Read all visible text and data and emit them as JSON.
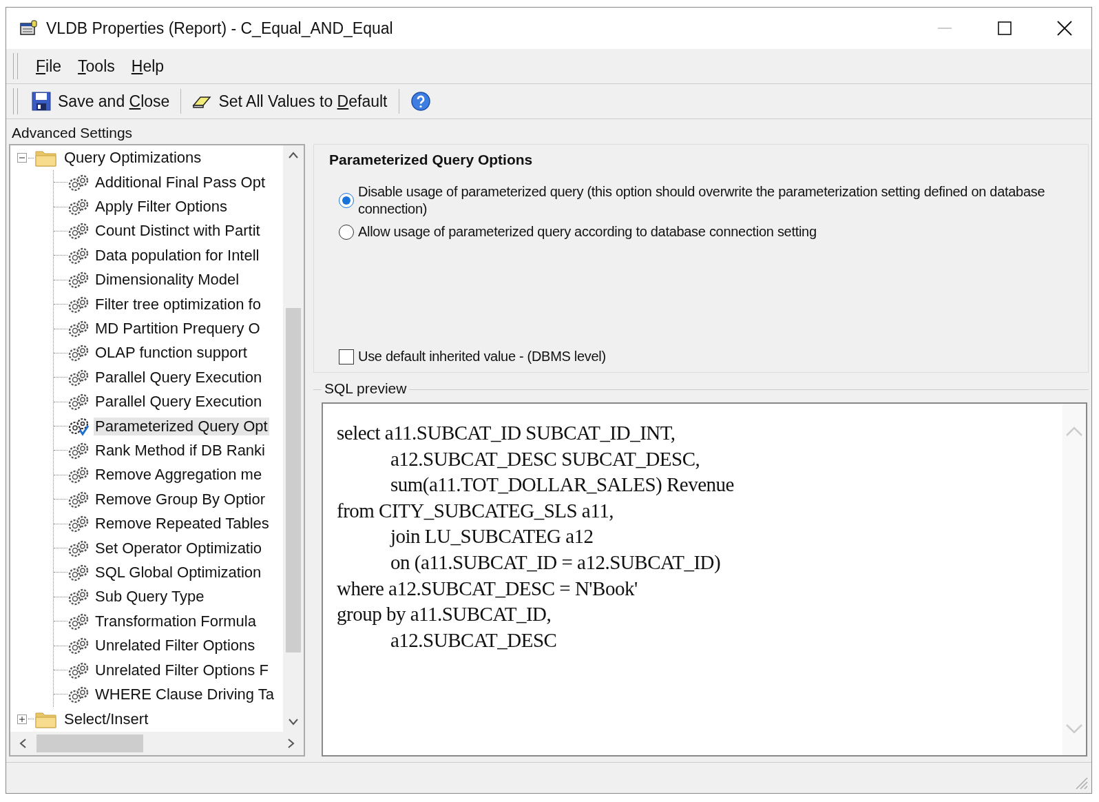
{
  "window": {
    "title": "VLDB Properties (Report) - C_Equal_AND_Equal"
  },
  "menu": [
    {
      "access_key": "F",
      "label_rest": "ile"
    },
    {
      "access_key": "T",
      "label_rest": "ools"
    },
    {
      "access_key": "H",
      "label_rest": "elp"
    }
  ],
  "toolbar": [
    {
      "kind": "save",
      "label_start": "Save and ",
      "access_key": "C",
      "label_rest": "lose"
    },
    {
      "kind": "default",
      "label_start": "Set All Values to ",
      "access_key": "D",
      "label_rest": "efault"
    },
    {
      "kind": "help"
    }
  ],
  "section_label": "Advanced Settings",
  "tree": [
    {
      "label": "Query Optimizations",
      "expanded": true,
      "children": [
        {
          "label": "Additional Final Pass Opt",
          "selected": false,
          "modified": false
        },
        {
          "label": "Apply Filter Options",
          "selected": false,
          "modified": false
        },
        {
          "label": "Count Distinct with Partit",
          "selected": false,
          "modified": false
        },
        {
          "label": "Data population for Intell",
          "selected": false,
          "modified": false
        },
        {
          "label": "Dimensionality Model",
          "selected": false,
          "modified": false
        },
        {
          "label": "Filter tree optimization fo",
          "selected": false,
          "modified": false
        },
        {
          "label": "MD Partition Prequery O",
          "selected": false,
          "modified": false
        },
        {
          "label": "OLAP function support",
          "selected": false,
          "modified": false
        },
        {
          "label": "Parallel Query Execution",
          "selected": false,
          "modified": false
        },
        {
          "label": "Parallel Query Execution",
          "selected": false,
          "modified": false
        },
        {
          "label": "Parameterized Query Opt",
          "selected": true,
          "modified": true
        },
        {
          "label": "Rank Method if DB Ranki",
          "selected": false,
          "modified": false
        },
        {
          "label": "Remove Aggregation me",
          "selected": false,
          "modified": false
        },
        {
          "label": "Remove Group By Optior",
          "selected": false,
          "modified": false
        },
        {
          "label": "Remove Repeated Tables",
          "selected": false,
          "modified": false
        },
        {
          "label": "Set Operator Optimizatio",
          "selected": false,
          "modified": false
        },
        {
          "label": "SQL Global Optimization",
          "selected": false,
          "modified": false
        },
        {
          "label": "Sub Query Type",
          "selected": false,
          "modified": false
        },
        {
          "label": "Transformation Formula",
          "selected": false,
          "modified": false
        },
        {
          "label": "Unrelated Filter Options",
          "selected": false,
          "modified": false
        },
        {
          "label": "Unrelated Filter Options F",
          "selected": false,
          "modified": false
        },
        {
          "label": "WHERE Clause Driving Ta",
          "selected": false,
          "modified": false
        }
      ]
    },
    {
      "label": "Select/Insert",
      "expanded": false
    }
  ],
  "options_panel": {
    "title": "Parameterized Query Options",
    "options": [
      {
        "label": "Disable usage of parameterized query (this option should overwrite the parameterization setting defined on database connection)",
        "selected": true
      },
      {
        "label": "Allow usage of parameterized query according to database connection setting",
        "selected": false
      }
    ],
    "inherit_checkbox": {
      "label": "Use default inherited value - (DBMS level)",
      "checked": false
    }
  },
  "sql_preview": {
    "title": "SQL preview",
    "lines": [
      {
        "text": "select a11.SUBCAT_ID SUBCAT_ID_INT,",
        "kind": "clause"
      },
      {
        "text": "a12.SUBCAT_DESC SUBCAT_DESC,",
        "kind": "continuation"
      },
      {
        "text": "sum(a11.TOT_DOLLAR_SALES) Revenue",
        "kind": "continuation"
      },
      {
        "text": "from CITY_SUBCATEG_SLS a11,",
        "kind": "clause"
      },
      {
        "text": "join LU_SUBCATEG a12",
        "kind": "continuation"
      },
      {
        "text": "on (a11.SUBCAT_ID = a12.SUBCAT_ID)",
        "kind": "continuation"
      },
      {
        "text": "where a12.SUBCAT_DESC = N'Book'",
        "kind": "clause"
      },
      {
        "text": "group by a11.SUBCAT_ID,",
        "kind": "clause"
      },
      {
        "text": "a12.SUBCAT_DESC",
        "kind": "continuation"
      }
    ]
  }
}
